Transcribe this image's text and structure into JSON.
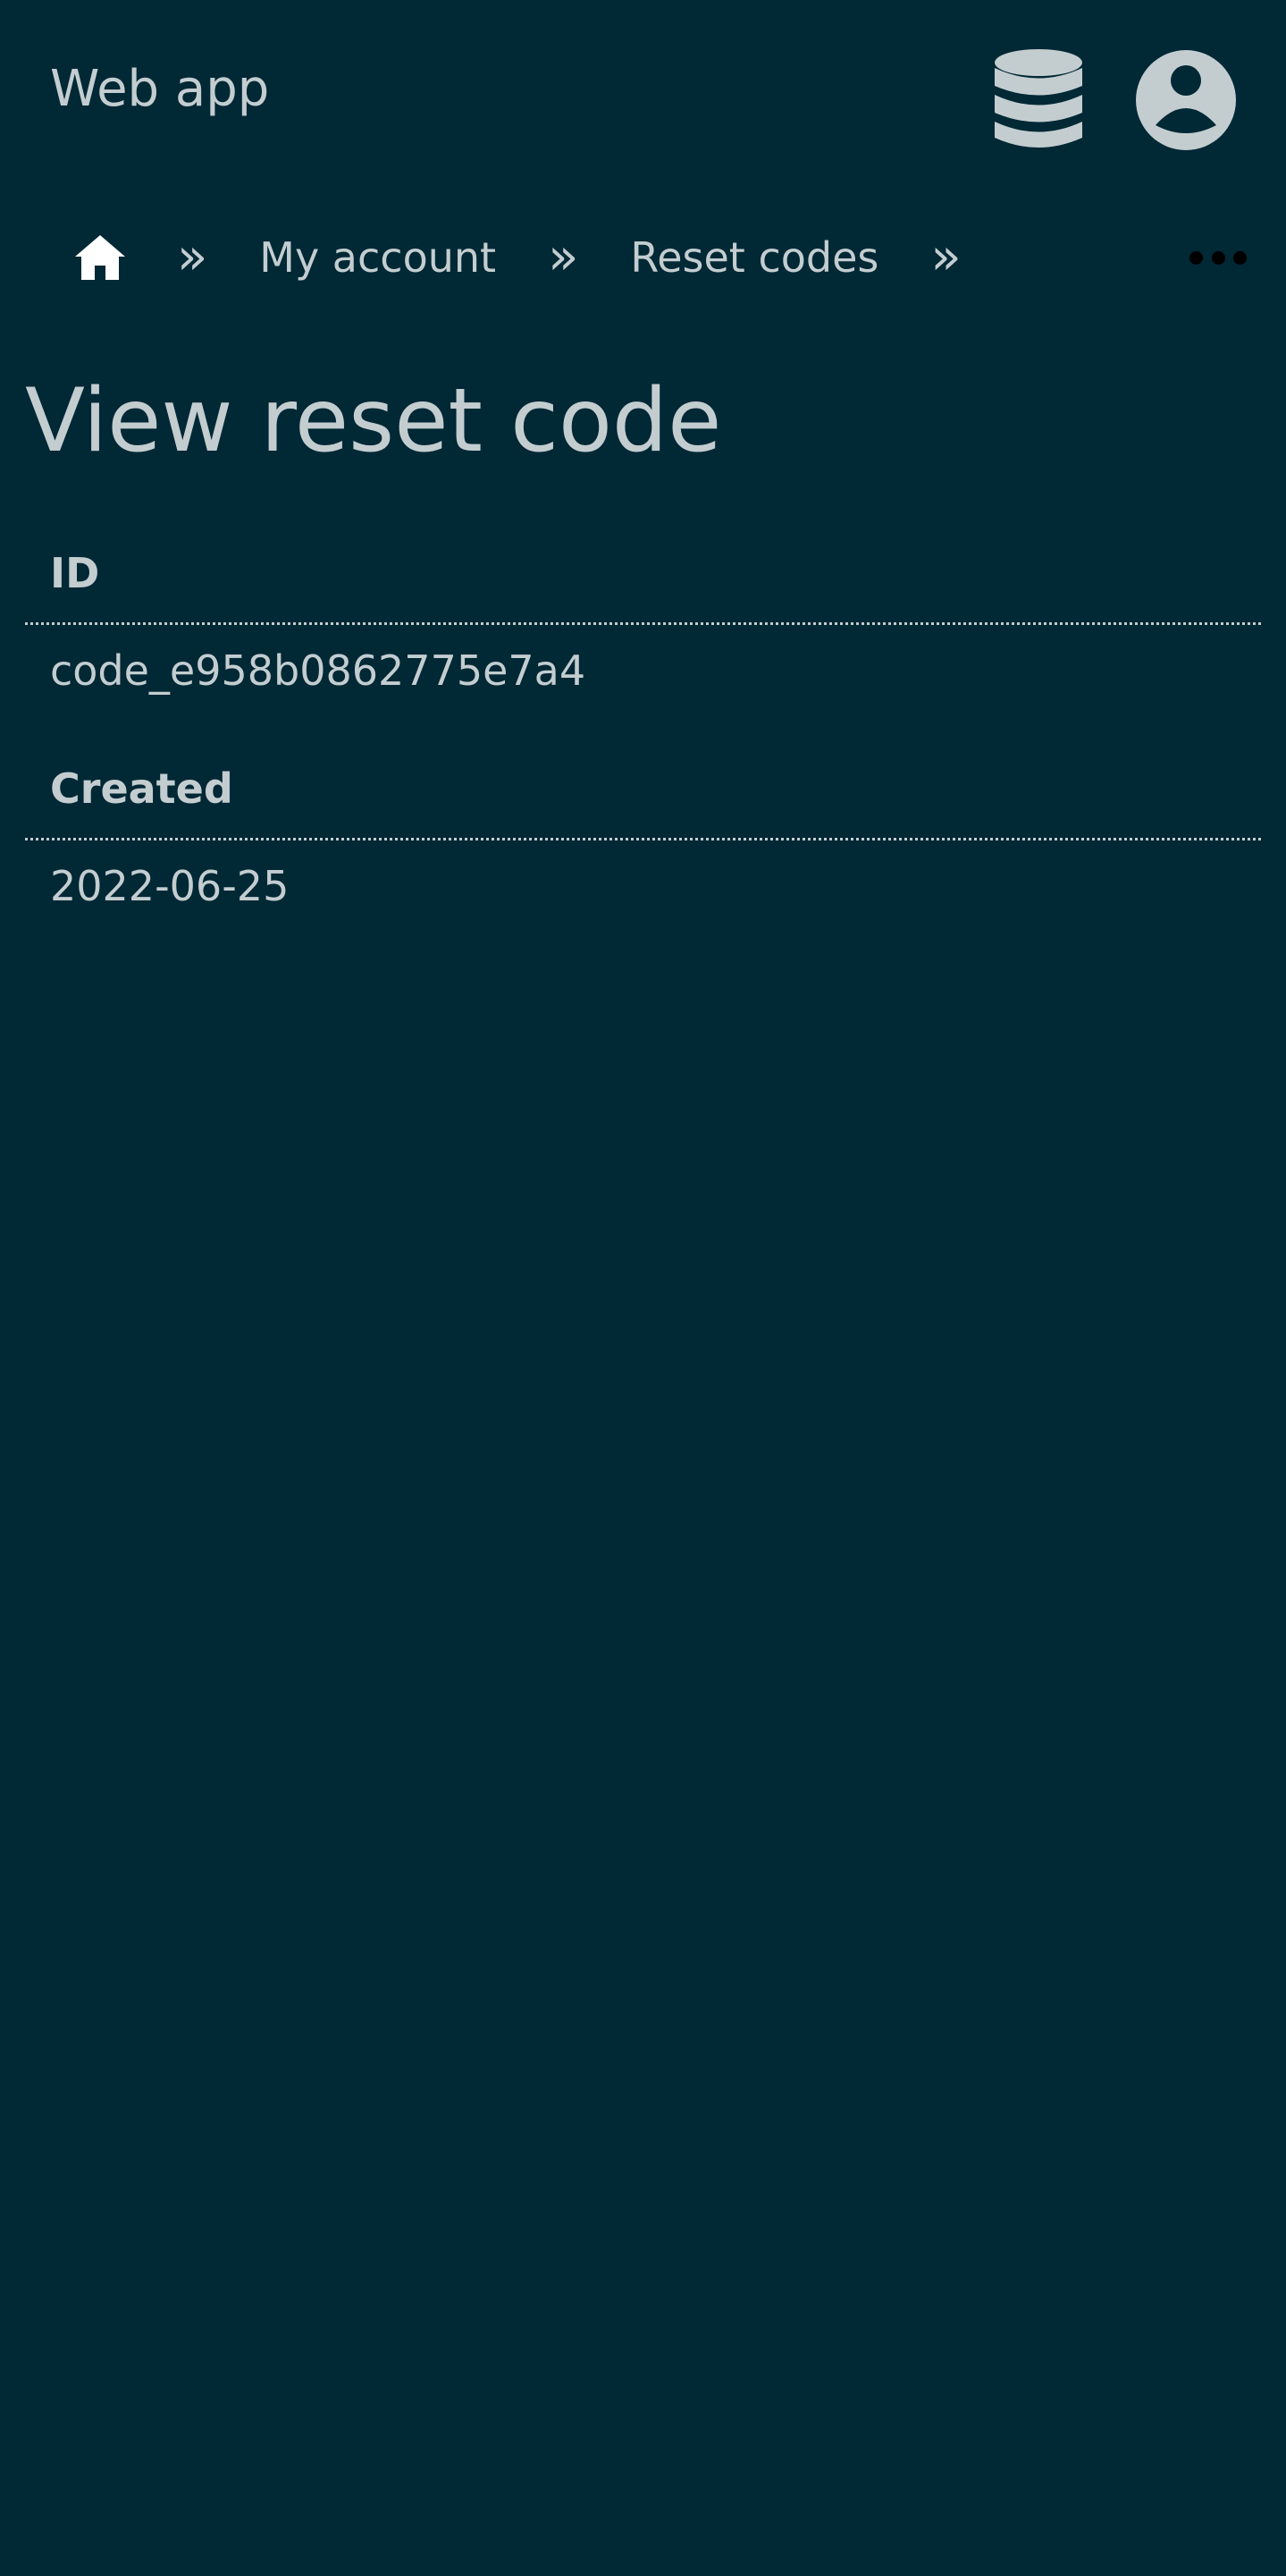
{
  "header": {
    "app_title": "Web app",
    "db_icon": "database-icon",
    "account_icon": "user-circle-icon"
  },
  "breadcrumbs": {
    "home_icon": "home-icon",
    "separator": "»",
    "items": [
      {
        "label": "My account"
      },
      {
        "label": "Reset codes"
      }
    ],
    "more_icon": "more-horizontal-icon"
  },
  "page": {
    "title": "View reset code"
  },
  "details": {
    "id_label": "ID",
    "id_value": "code_e958b0862775e7a4",
    "created_label": "Created",
    "created_value": "2022-06-25"
  },
  "colors": {
    "background": "#002835",
    "text": "#c3cdd0",
    "home_icon": "#ffffff",
    "more_dots": "#000000"
  }
}
